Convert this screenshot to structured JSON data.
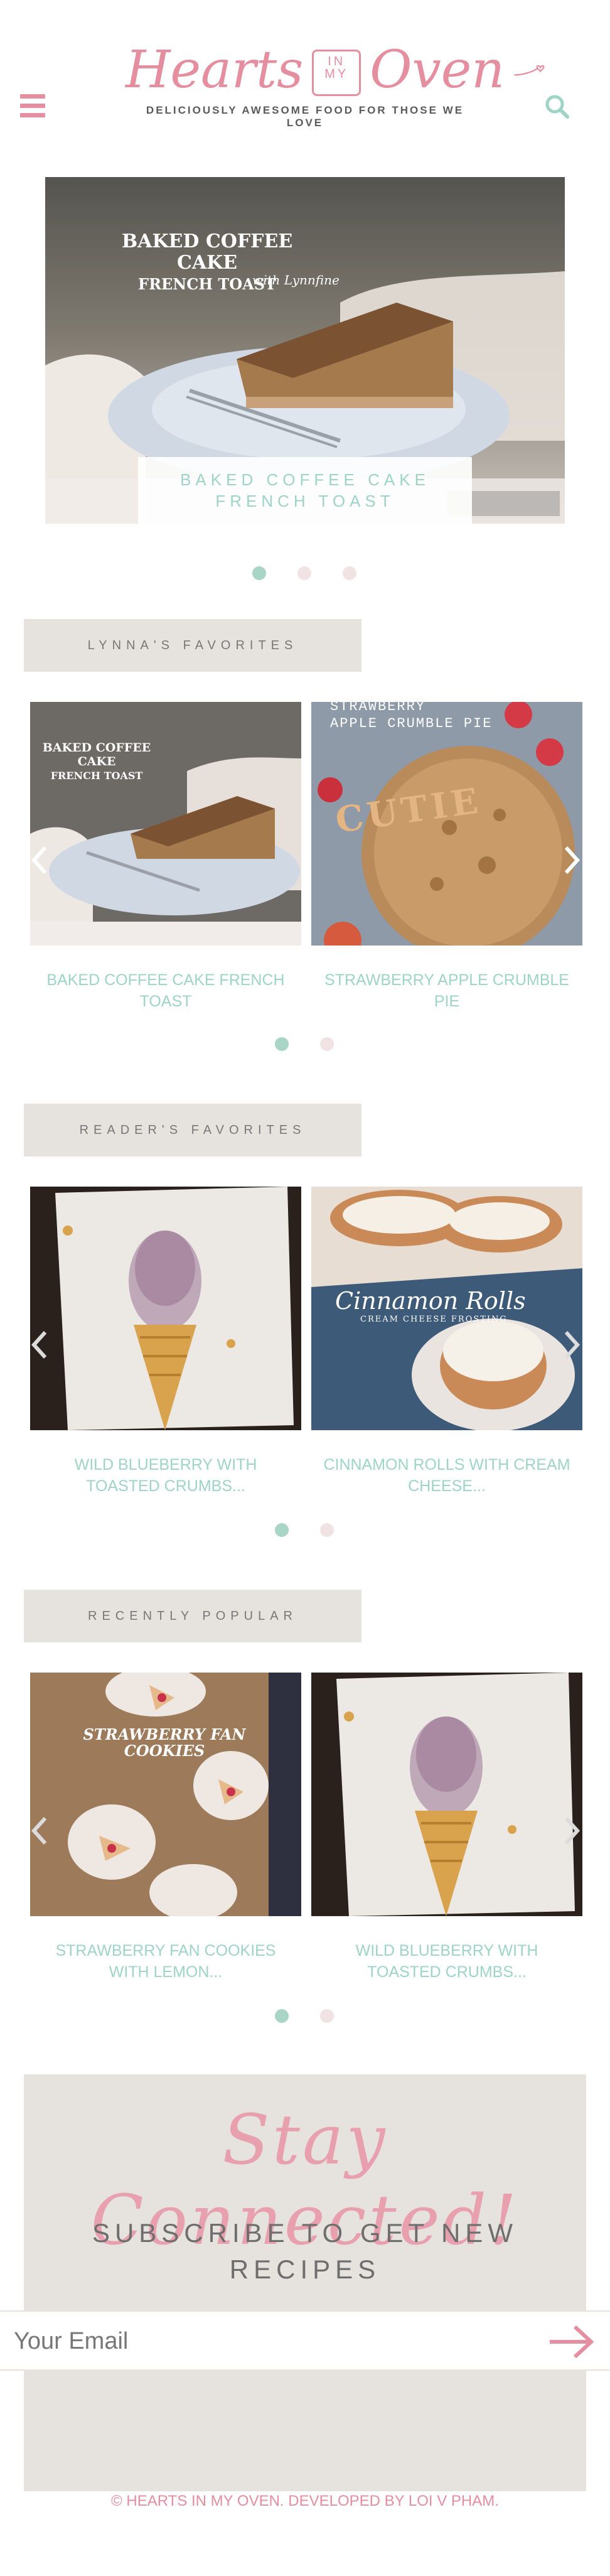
{
  "header": {
    "logo_word1": "Hearts",
    "logo_inmy": "IN MY",
    "logo_word2": "Oven",
    "tagline": "DELICIOUSLY AWESOME FOOD FOR THOSE WE LOVE"
  },
  "hero": {
    "image_title_line1": "BAKED COFFEE CAKE",
    "image_title_line2": "FRENCH TOAST",
    "image_signature": "with Lynnfine",
    "caption": "BAKED COFFEE CAKE FRENCH TOAST",
    "slides": 3,
    "active_slide": 1
  },
  "sections": [
    {
      "label": "LYNNA'S FAVORITES",
      "cards": [
        {
          "title": "BAKED COFFEE CAKE FRENCH TOAST",
          "image_text_line1": "BAKED COFFEE CAKE",
          "image_text_line2": "FRENCH TOAST"
        },
        {
          "title": "STRAWBERRY APPLE CRUMBLE PIE",
          "image_text_line1": "STRAWBERRY",
          "image_text_line2": "APPLE CRUMBLE PIE"
        }
      ]
    },
    {
      "label": "READER'S FAVORITES",
      "cards": [
        {
          "title": "WILD BLUEBERRY WITH TOASTED CRUMBS...",
          "image_text_line1": "",
          "image_text_line2": ""
        },
        {
          "title": "CINNAMON ROLLS WITH CREAM CHEESE...",
          "image_text_line1": "Cinnamon Rolls",
          "image_text_line2": "CREAM CHEESE FROSTING"
        }
      ]
    },
    {
      "label": "RECENTLY POPULAR",
      "cards": [
        {
          "title": "STRAWBERRY FAN COOKIES WITH LEMON...",
          "image_text_line1": "STRAWBERRY FAN",
          "image_text_line2": "COOKIES"
        },
        {
          "title": "WILD BLUEBERRY WITH TOASTED CRUMBS...",
          "image_text_line1": "",
          "image_text_line2": ""
        }
      ]
    }
  ],
  "newsletter": {
    "title": "Stay Connected!",
    "subtitle": "SUBSCRIBE TO GET NEW RECIPES",
    "email_placeholder": "Your Email"
  },
  "footer": {
    "text": "© HEARTS IN MY OVEN. DEVELOPED BY LOI V PHAM."
  },
  "colors": {
    "brand_pink": "#e58ea0",
    "mint": "#9ed4c6",
    "label_bg": "#e6e3df"
  },
  "icons": {
    "menu": "hamburger-icon",
    "search": "search-icon",
    "prev": "chevron-left-icon",
    "next": "chevron-right-icon",
    "submit": "arrow-right-icon"
  }
}
